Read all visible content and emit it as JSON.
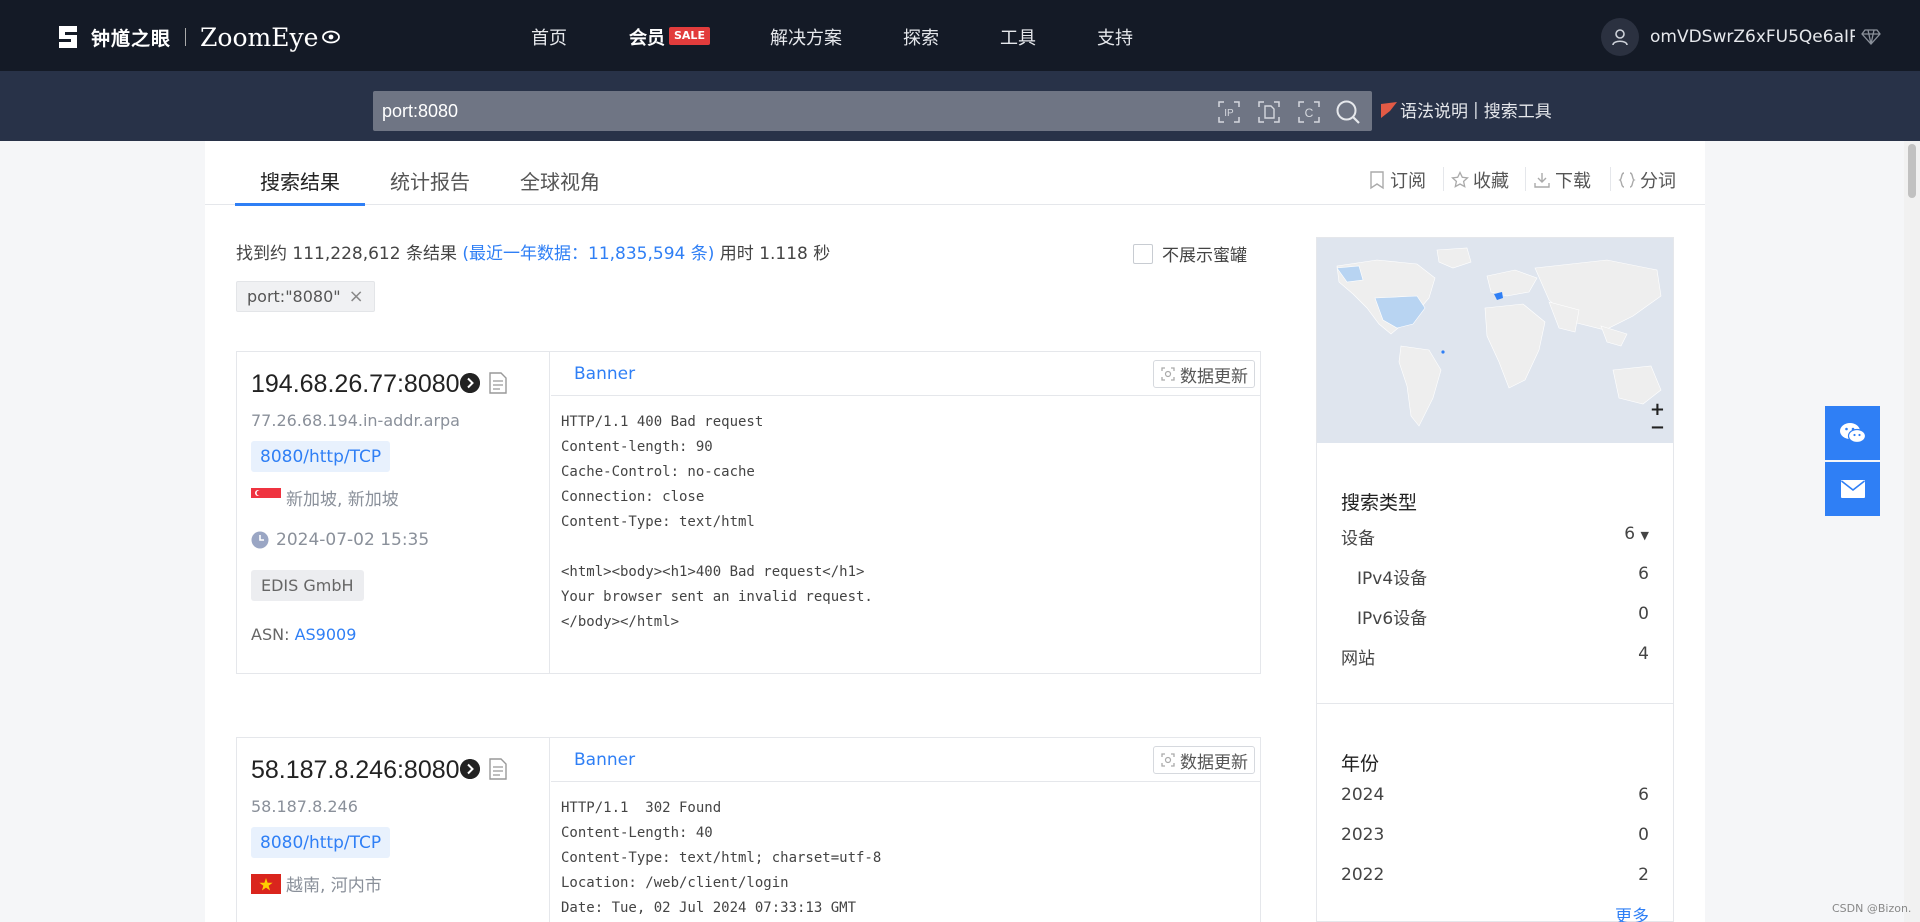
{
  "brand": {
    "name_cn": "钟馗之眼",
    "name_en": "ZoomEye"
  },
  "nav": {
    "home": "首页",
    "member": "会员",
    "sale_badge": "SALE",
    "solutions": "解决方案",
    "explore": "探索",
    "tools": "工具",
    "support": "支持"
  },
  "user": {
    "name": "omVDSwrZ6xFU5Qe6aIP..."
  },
  "search": {
    "value": "port:8080",
    "syntax_help": "语法说明",
    "search_tools": "搜索工具"
  },
  "tabs": [
    {
      "label": "搜索结果"
    },
    {
      "label": "统计报告"
    },
    {
      "label": "全球视角"
    }
  ],
  "toolbar": {
    "subscribe": "订阅",
    "favorite": "收藏",
    "download": "下载",
    "tokenize": "分词"
  },
  "summary": {
    "prefix": "找到约 111,228,612 条结果",
    "recent": "(最近一年数据：11,835,594 条)",
    "elapsed": "用时 1.118 秒",
    "hide_honeypot": "不展示蜜罐"
  },
  "filter_tag": "port:\"8080\"",
  "results": [
    {
      "ip": "194.68.26.77:8080",
      "rdns": "77.26.68.194.in-addr.arpa",
      "port_tag": "8080/http/TCP",
      "location": "新加坡, 新加坡",
      "time": "2024-07-02 15:35",
      "org": "EDIS GmbH",
      "asn_label": "ASN:",
      "asn": "AS9009",
      "banner_tab": "Banner",
      "update_label": "数据更新",
      "banner": "HTTP/1.1 400 Bad request\nContent-length: 90\nCache-Control: no-cache\nConnection: close\nContent-Type: text/html\n\n<html><body><h1>400 Bad request</h1>\nYour browser sent an invalid request.\n</body></html>"
    },
    {
      "ip": "58.187.8.246:8080",
      "rdns": "58.187.8.246",
      "port_tag": "8080/http/TCP",
      "location": "越南, 河内市",
      "banner_tab": "Banner",
      "update_label": "数据更新",
      "banner": "HTTP/1.1  302 Found\nContent-Length: 40\nContent-Type: text/html; charset=utf-8\nLocation: /web/client/login\nDate: Tue, 02 Jul 2024 07:33:13 GMT"
    }
  ],
  "sidebar": {
    "map_zoom_in": "+",
    "map_zoom_out": "−",
    "search_type": {
      "title": "搜索类型",
      "rows": [
        {
          "label": "设备",
          "count": "6"
        },
        {
          "label": "IPv4设备",
          "count": "6"
        },
        {
          "label": "IPv6设备",
          "count": "0"
        },
        {
          "label": "网站",
          "count": "4"
        }
      ]
    },
    "year": {
      "title": "年份",
      "rows": [
        {
          "label": "2024",
          "count": "6"
        },
        {
          "label": "2023",
          "count": "0"
        },
        {
          "label": "2022",
          "count": "2"
        }
      ],
      "more": "更多"
    }
  },
  "watermark": "CSDN @Bizon.",
  "colors": {
    "accent": "#2f7ff5",
    "topnav": "#141a26",
    "searchband": "#283248",
    "sale": "#e23c3c"
  }
}
